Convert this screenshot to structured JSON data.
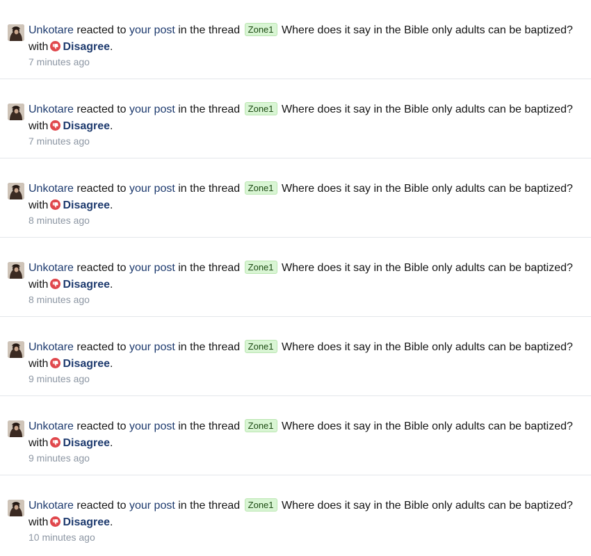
{
  "colors": {
    "link": "#1d3a6e",
    "prefix_bg": "#d9f5d4",
    "reaction_red": "#e0474c",
    "time": "#8c96a3"
  },
  "notifications": [
    {
      "user": "Unkotare",
      "reacted_to": "reacted to",
      "post_link": "your post",
      "in_thread": "in the thread",
      "prefix": "Zone1",
      "thread_title": "Where does it say in the Bible only adults can be baptized?",
      "with": "with",
      "reaction": "Disagree",
      "reaction_icon": "thumbs-down-icon",
      "period": ".",
      "time": "7 minutes ago"
    },
    {
      "user": "Unkotare",
      "reacted_to": "reacted to",
      "post_link": "your post",
      "in_thread": "in the thread",
      "prefix": "Zone1",
      "thread_title": "Where does it say in the Bible only adults can be baptized?",
      "with": "with",
      "reaction": "Disagree",
      "reaction_icon": "thumbs-down-icon",
      "period": ".",
      "time": "7 minutes ago"
    },
    {
      "user": "Unkotare",
      "reacted_to": "reacted to",
      "post_link": "your post",
      "in_thread": "in the thread",
      "prefix": "Zone1",
      "thread_title": "Where does it say in the Bible only adults can be baptized?",
      "with": "with",
      "reaction": "Disagree",
      "reaction_icon": "thumbs-down-icon",
      "period": ".",
      "time": "8 minutes ago"
    },
    {
      "user": "Unkotare",
      "reacted_to": "reacted to",
      "post_link": "your post",
      "in_thread": "in the thread",
      "prefix": "Zone1",
      "thread_title": "Where does it say in the Bible only adults can be baptized?",
      "with": "with",
      "reaction": "Disagree",
      "reaction_icon": "thumbs-down-icon",
      "period": ".",
      "time": "8 minutes ago"
    },
    {
      "user": "Unkotare",
      "reacted_to": "reacted to",
      "post_link": "your post",
      "in_thread": "in the thread",
      "prefix": "Zone1",
      "thread_title": "Where does it say in the Bible only adults can be baptized?",
      "with": "with",
      "reaction": "Disagree",
      "reaction_icon": "thumbs-down-icon",
      "period": ".",
      "time": "9 minutes ago"
    },
    {
      "user": "Unkotare",
      "reacted_to": "reacted to",
      "post_link": "your post",
      "in_thread": "in the thread",
      "prefix": "Zone1",
      "thread_title": "Where does it say in the Bible only adults can be baptized?",
      "with": "with",
      "reaction": "Disagree",
      "reaction_icon": "thumbs-down-icon",
      "period": ".",
      "time": "9 minutes ago"
    },
    {
      "user": "Unkotare",
      "reacted_to": "reacted to",
      "post_link": "your post",
      "in_thread": "in the thread",
      "prefix": "Zone1",
      "thread_title": "Where does it say in the Bible only adults can be baptized?",
      "with": "with",
      "reaction": "Disagree",
      "reaction_icon": "thumbs-down-icon",
      "period": ".",
      "time": "10 minutes ago"
    }
  ]
}
